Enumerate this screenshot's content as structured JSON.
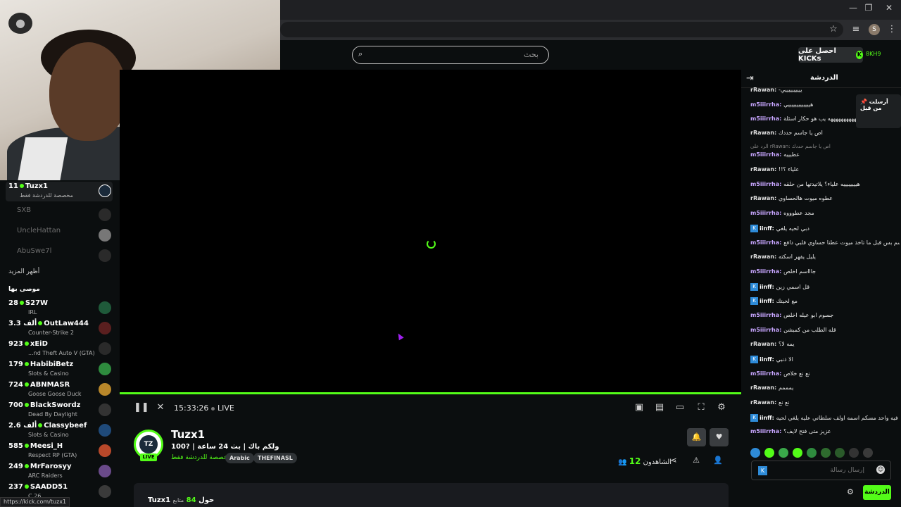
{
  "browser": {
    "window_controls": [
      "—",
      "❐",
      "✕"
    ],
    "profile_initial": "S",
    "status_url": "https://kick.com/tuzx1"
  },
  "topbar": {
    "search_placeholder": "بحث",
    "kicks_label": "احصل على KICKs",
    "user_label": "8KH9"
  },
  "sidebar": {
    "current": {
      "count": "11",
      "name": "Tuzx1",
      "sub": "مخصصة للدردشة فقط"
    },
    "offline": [
      "SXB",
      "UncleHattan",
      "AbuSwe7l"
    ],
    "show_more": "أظهر المزيد",
    "recommended_heading": "موصى بها",
    "recommended": [
      {
        "count": "28",
        "name": "S27W",
        "sub": "IRL",
        "color": "#1f5a3a"
      },
      {
        "count": "3.3 ألف",
        "name": "OutLaw444",
        "sub": "Counter-Strike 2",
        "color": "#5a1f1f"
      },
      {
        "count": "923",
        "name": "xEiD",
        "sub": "...nd Theft Auto V (GTA)",
        "color": "#2a2a2a"
      },
      {
        "count": "179",
        "name": "HabibiBetz",
        "sub": "Slots & Casino",
        "color": "#2e8b3e"
      },
      {
        "count": "724",
        "name": "ABNMASR",
        "sub": "Goose Goose Duck",
        "color": "#b8872a"
      },
      {
        "count": "700",
        "name": "BlackSwordz",
        "sub": "Dead By Daylight",
        "color": "#333333"
      },
      {
        "count": "2.6 ألف",
        "name": "Classybeef",
        "sub": "Slots & Casino",
        "color": "#1f4a7a"
      },
      {
        "count": "585",
        "name": "Meesi_H",
        "sub": "Respect RP (GTA)",
        "color": "#b8482a"
      },
      {
        "count": "249",
        "name": "MrFarosyy",
        "sub": "ARC Raiders",
        "color": "#6a4a8a"
      },
      {
        "count": "237",
        "name": "SAADD51",
        "sub": "C 26",
        "color": "#3a3a3a"
      }
    ]
  },
  "player": {
    "time": "15:33:26",
    "live": "LIVE"
  },
  "channel": {
    "avatar_text": "TZ",
    "live_tag": "LIVE",
    "name": "Tuzx1",
    "title": "ولكم باك | بث 24 ساعة | ?100",
    "category": "مخصصة للدردشة فقط",
    "tags": [
      "Arabic",
      "THEFINASL"
    ],
    "viewers_label": "الشاهدون",
    "viewers_count": "12",
    "about_followers": "84",
    "about_followers_label": "متابع",
    "about_title": "Tuzx1 حول"
  },
  "chat": {
    "title": "الدردشة",
    "pinned_label": "أرسلت من قبل",
    "messages": [
      {
        "user": "rRawan",
        "cls": "u-rr",
        "text": "-ييييييييييي",
        "badge": false
      },
      {
        "user": "m5iiirrha",
        "cls": "u-m5",
        "text": "هيييييييييييييي",
        "badge": false
      },
      {
        "user": "m5iiirrha",
        "cls": "u-m5",
        "text": "هههههههههههه يب هو حكار اسئلة",
        "badge": false
      },
      {
        "user": "rRawan",
        "cls": "u-rr",
        "text": "اص يا جاسم حددك",
        "badge": false
      },
      {
        "user": "m5iiirrha",
        "cls": "u-m5",
        "text": "عطيييه",
        "badge": false
      },
      {
        "user": "rRawan",
        "cls": "u-rr",
        "text": "!!علياء ؟",
        "badge": false
      },
      {
        "user": "m5iiirrha",
        "cls": "u-m5",
        "text": "هييييييييه علياء؟ يلاتيدتها من حلقه",
        "badge": false
      },
      {
        "user": "rRawan",
        "cls": "u-rr",
        "text": "عطوه ميوت هالحساوي",
        "badge": false
      },
      {
        "user": "m5iiirrha",
        "cls": "u-m5",
        "text": "مجد عطوووه",
        "badge": false
      },
      {
        "user": "iinff",
        "cls": "u-ii",
        "text": "دبي لحيه يلغي",
        "badge": true
      },
      {
        "user": "m5iiirrha",
        "cls": "u-m5",
        "text": "جاسم بس قبل ما تاخذ ميوت عطنا حساوي قلبي دافع",
        "badge": false
      },
      {
        "user": "rRawan",
        "cls": "u-rr",
        "text": "يليل يفهر اسكته",
        "badge": false
      },
      {
        "user": "m5iiirrha",
        "cls": "u-m5",
        "text": "جاااسم اخلص",
        "badge": false
      },
      {
        "user": "iinff",
        "cls": "u-ii",
        "text": "قل اسمي زين",
        "badge": true
      },
      {
        "user": "iinff",
        "cls": "u-ii",
        "text": "مع لحيتك",
        "badge": true
      },
      {
        "user": "m5iiirrha",
        "cls": "u-m5",
        "text": "جسوم ابو عيله اخلص",
        "badge": false
      },
      {
        "user": "m5iiirrha",
        "cls": "u-m5",
        "text": "قله الطلب من كمبشن",
        "badge": false
      },
      {
        "user": "rRawan",
        "cls": "u-rr",
        "text": "يمه لا؟",
        "badge": false
      },
      {
        "user": "iinff",
        "cls": "u-ii",
        "text": "الا ذنبي",
        "badge": true
      },
      {
        "user": "m5iiirrha",
        "cls": "u-m5",
        "text": "نع نع خلاص",
        "badge": false
      },
      {
        "user": "rRawan",
        "cls": "u-rr",
        "text": "يمممم",
        "badge": false
      },
      {
        "user": "rRawan",
        "cls": "u-rr",
        "text": "نع نع",
        "badge": false
      },
      {
        "user": "iinff",
        "cls": "u-ii",
        "text": "بالله فيه واحد مسكم اسمه اولف سلطاني عليه يلغي لحيه",
        "badge": true
      },
      {
        "user": "m5iiirrha",
        "cls": "u-m5",
        "text": "عزيز متى فتح لايف؟",
        "badge": false
      }
    ],
    "reply_to": "الرد على rRawan: اص يا جاسم حددك",
    "input_placeholder": "إرسال رسالة",
    "send_label": "الدردشة",
    "emote_colors": [
      "#2e8bd8",
      "#53fc18",
      "#3aa84a",
      "#53fc18",
      "#2e8b3e",
      "#2e6b2e",
      "#2a5a2a",
      "#333333",
      "#3a3a3a"
    ]
  }
}
